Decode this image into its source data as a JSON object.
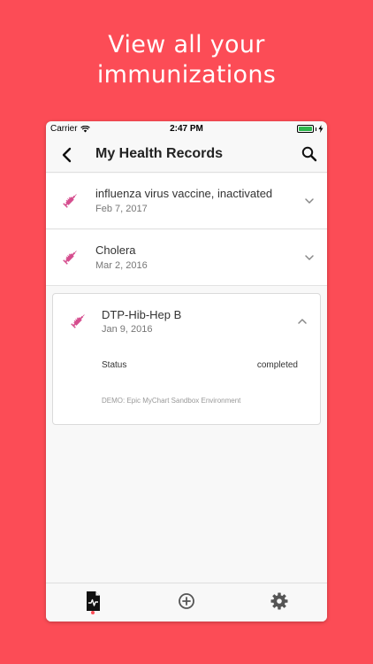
{
  "headline": {
    "line1": "View all your",
    "line2": "immunizations"
  },
  "status_bar": {
    "carrier": "Carrier",
    "time": "2:47 PM"
  },
  "nav": {
    "title": "My Health Records"
  },
  "records": [
    {
      "name": "influenza virus vaccine, inactivated",
      "date": "Feb 7, 2017"
    },
    {
      "name": "Cholera",
      "date": "Mar 2, 2016"
    }
  ],
  "expanded_record": {
    "name": "DTP-Hib-Hep B",
    "date": "Jan 9, 2016",
    "status_label": "Status",
    "status_value": "completed",
    "source": "DEMO: Epic MyChart Sandbox Environment"
  },
  "colors": {
    "background": "#fc4c56",
    "syringe_icon": "#d54d8e",
    "battery": "#2db84d"
  },
  "icons": {
    "back": "chevron-left-icon",
    "search": "search-icon",
    "syringe": "syringe-icon",
    "tab_records": "health-record-icon",
    "tab_add": "add-circle-icon",
    "tab_settings": "gear-icon"
  }
}
